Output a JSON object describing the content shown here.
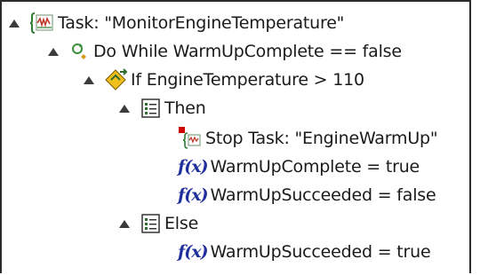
{
  "tree": {
    "task": {
      "label": "Task: \"MonitorEngineTemperature\"",
      "icon": "task-icon"
    },
    "do_while": {
      "label": "Do While WarmUpComplete == false",
      "icon": "loop-icon"
    },
    "if": {
      "label": "If EngineTemperature > 110",
      "icon": "condition-icon"
    },
    "then": {
      "label": "Then",
      "icon": "block-icon"
    },
    "stop_task": {
      "label": "Stop Task: \"EngineWarmUp\"",
      "icon": "stop-task-icon"
    },
    "then_fx1": {
      "label": "WarmUpComplete = true",
      "icon": "function-icon"
    },
    "then_fx2": {
      "label": "WarmUpSucceeded = false",
      "icon": "function-icon"
    },
    "else": {
      "label": "Else",
      "icon": "block-icon"
    },
    "else_fx1": {
      "label": "WarmUpSucceeded = true",
      "icon": "function-icon"
    }
  },
  "colors": {
    "expander": "#3a3a3a",
    "fx_blue": "#1f2f9e",
    "task_icon_brace": "#2e7d32",
    "task_icon_wave": "#c0392b",
    "condition_diamond": "#f2c01c",
    "stop_marker": "#d00000"
  }
}
